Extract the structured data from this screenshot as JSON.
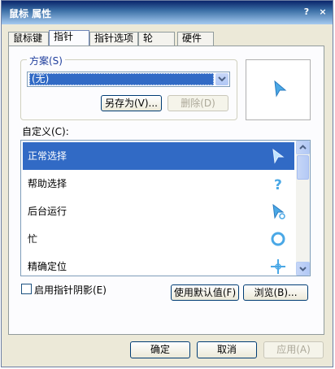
{
  "window": {
    "title": "鼠标 属性",
    "help_glyph": "?",
    "close_glyph": "×"
  },
  "tabs": [
    {
      "label": "鼠标键",
      "active": false
    },
    {
      "label": "指针",
      "active": true
    },
    {
      "label": "指针选项",
      "active": false
    },
    {
      "label": "轮",
      "active": false
    },
    {
      "label": "硬件",
      "active": false
    }
  ],
  "scheme": {
    "label": "方案(S)",
    "selected": "(无)",
    "save_as": "另存为(V)...",
    "delete": "删除(D)"
  },
  "customize": {
    "label": "自定义(C):",
    "items": [
      {
        "label": "正常选择",
        "icon": "normal-select-arrow-icon",
        "selected": true
      },
      {
        "label": "帮助选择",
        "icon": "help-select-icon",
        "selected": false
      },
      {
        "label": "后台运行",
        "icon": "working-in-background-icon",
        "selected": false
      },
      {
        "label": "忙",
        "icon": "busy-icon",
        "selected": false
      },
      {
        "label": "精确定位",
        "icon": "precision-select-icon",
        "selected": false
      }
    ]
  },
  "options": {
    "shadow_label": "启用指针阴影(E)",
    "shadow_checked": false,
    "use_default": "使用默认值(F)",
    "browse": "浏览(B)..."
  },
  "footer": {
    "ok": "确定",
    "cancel": "取消",
    "apply": "应用(A)"
  },
  "colors": {
    "accent": "#316ac5",
    "cursor_blue": "#4aa8e6",
    "titlebar": "#0a246a"
  }
}
